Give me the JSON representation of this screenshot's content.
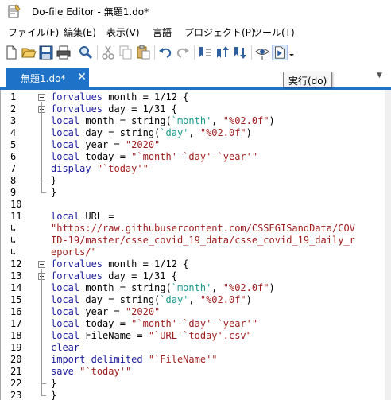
{
  "window": {
    "title": "Do-file Editor - 無題1.do*"
  },
  "menu": {
    "items": [
      "ファイル(F)",
      "編集(E)",
      "表示(V)",
      "言語",
      "プロジェクト(P)",
      "ツール(T)"
    ]
  },
  "toolbar": {
    "icons": [
      "new-file-icon",
      "open-folder-icon",
      "save-icon",
      "print-icon",
      "find-icon",
      "cut-icon",
      "copy-icon",
      "paste-icon",
      "undo-icon",
      "redo-icon",
      "toggle-bookmark-icon",
      "previous-bookmark-icon",
      "next-bookmark-icon",
      "show-icon",
      "execute-icon",
      "dropdown-arrow-icon"
    ]
  },
  "tab": {
    "label": "無題1.do*",
    "close": "✕",
    "tooltip": "実行(do)"
  },
  "colors": {
    "accent": "#1e73c8",
    "keyword": "#1d1d9e",
    "string": "#9e1c1c",
    "macro": "#1a9a8c"
  },
  "code_lines": [
    {
      "n": "1",
      "parts": [
        [
          "kw",
          "forvalues"
        ],
        [
          "txt",
          " month = 1/12 {"
        ]
      ]
    },
    {
      "n": "2",
      "parts": [
        [
          "kw",
          "forvalues"
        ],
        [
          "txt",
          " day = 1/31 {"
        ]
      ]
    },
    {
      "n": "3",
      "parts": [
        [
          "kw",
          "local"
        ],
        [
          "txt",
          " month = string("
        ],
        [
          "mac",
          "`month'"
        ],
        [
          "txt",
          ", "
        ],
        [
          "str",
          "\"%02.0f\""
        ],
        [
          "txt",
          ")"
        ]
      ]
    },
    {
      "n": "4",
      "parts": [
        [
          "kw",
          "local"
        ],
        [
          "txt",
          " day = string("
        ],
        [
          "mac",
          "`day'"
        ],
        [
          "txt",
          ", "
        ],
        [
          "str",
          "\"%02.0f\""
        ],
        [
          "txt",
          ")"
        ]
      ]
    },
    {
      "n": "5",
      "parts": [
        [
          "kw",
          "local"
        ],
        [
          "txt",
          " year = "
        ],
        [
          "str",
          "\"2020\""
        ]
      ]
    },
    {
      "n": "6",
      "parts": [
        [
          "kw",
          "local"
        ],
        [
          "txt",
          " today = "
        ],
        [
          "str",
          "\"`month'-`day'-`year'\""
        ]
      ]
    },
    {
      "n": "7",
      "parts": [
        [
          "kw",
          "display"
        ],
        [
          "txt",
          " "
        ],
        [
          "str",
          "\"`today'\""
        ]
      ]
    },
    {
      "n": "8",
      "parts": [
        [
          "txt",
          "}"
        ]
      ]
    },
    {
      "n": "9",
      "parts": [
        [
          "txt",
          "}"
        ]
      ]
    },
    {
      "n": "10",
      "parts": []
    },
    {
      "n": "11",
      "parts": [
        [
          "kw",
          "local"
        ],
        [
          "txt",
          " URL ="
        ]
      ]
    },
    {
      "n": "↳",
      "parts": [
        [
          "str",
          "\"https://raw.githubusercontent.com/CSSEGISandData/COV"
        ]
      ]
    },
    {
      "n": "↳",
      "parts": [
        [
          "str",
          "ID-19/master/csse_covid_19_data/csse_covid_19_daily_r"
        ]
      ]
    },
    {
      "n": "↳",
      "parts": [
        [
          "str",
          "eports/\""
        ]
      ]
    },
    {
      "n": "12",
      "parts": [
        [
          "kw",
          "forvalues"
        ],
        [
          "txt",
          " month = 1/12 {"
        ]
      ]
    },
    {
      "n": "13",
      "parts": [
        [
          "kw",
          "forvalues"
        ],
        [
          "txt",
          " day = 1/31 {"
        ]
      ]
    },
    {
      "n": "14",
      "parts": [
        [
          "kw",
          "local"
        ],
        [
          "txt",
          " month = string("
        ],
        [
          "mac",
          "`month'"
        ],
        [
          "txt",
          ", "
        ],
        [
          "str",
          "\"%02.0f\""
        ],
        [
          "txt",
          ")"
        ]
      ]
    },
    {
      "n": "15",
      "parts": [
        [
          "kw",
          "local"
        ],
        [
          "txt",
          " day = string("
        ],
        [
          "mac",
          "`day'"
        ],
        [
          "txt",
          ", "
        ],
        [
          "str",
          "\"%02.0f\""
        ],
        [
          "txt",
          ")"
        ]
      ]
    },
    {
      "n": "16",
      "parts": [
        [
          "kw",
          "local"
        ],
        [
          "txt",
          " year = "
        ],
        [
          "str",
          "\"2020\""
        ]
      ]
    },
    {
      "n": "17",
      "parts": [
        [
          "kw",
          "local"
        ],
        [
          "txt",
          " today = "
        ],
        [
          "str",
          "\"`month'-`day'-`year'\""
        ]
      ]
    },
    {
      "n": "18",
      "parts": [
        [
          "kw",
          "local"
        ],
        [
          "txt",
          " FileName = "
        ],
        [
          "str",
          "\"`URL'`today'.csv\""
        ]
      ]
    },
    {
      "n": "19",
      "parts": [
        [
          "kw",
          "clear"
        ]
      ]
    },
    {
      "n": "20",
      "parts": [
        [
          "kw",
          "import delimited"
        ],
        [
          "txt",
          " "
        ],
        [
          "str",
          "\"`FileName'\""
        ]
      ]
    },
    {
      "n": "21",
      "parts": [
        [
          "kw",
          "save"
        ],
        [
          "txt",
          " "
        ],
        [
          "str",
          "\"`today'\""
        ]
      ]
    },
    {
      "n": "22",
      "parts": [
        [
          "txt",
          "}"
        ]
      ]
    },
    {
      "n": "23",
      "parts": [
        [
          "txt",
          "}"
        ]
      ]
    }
  ]
}
